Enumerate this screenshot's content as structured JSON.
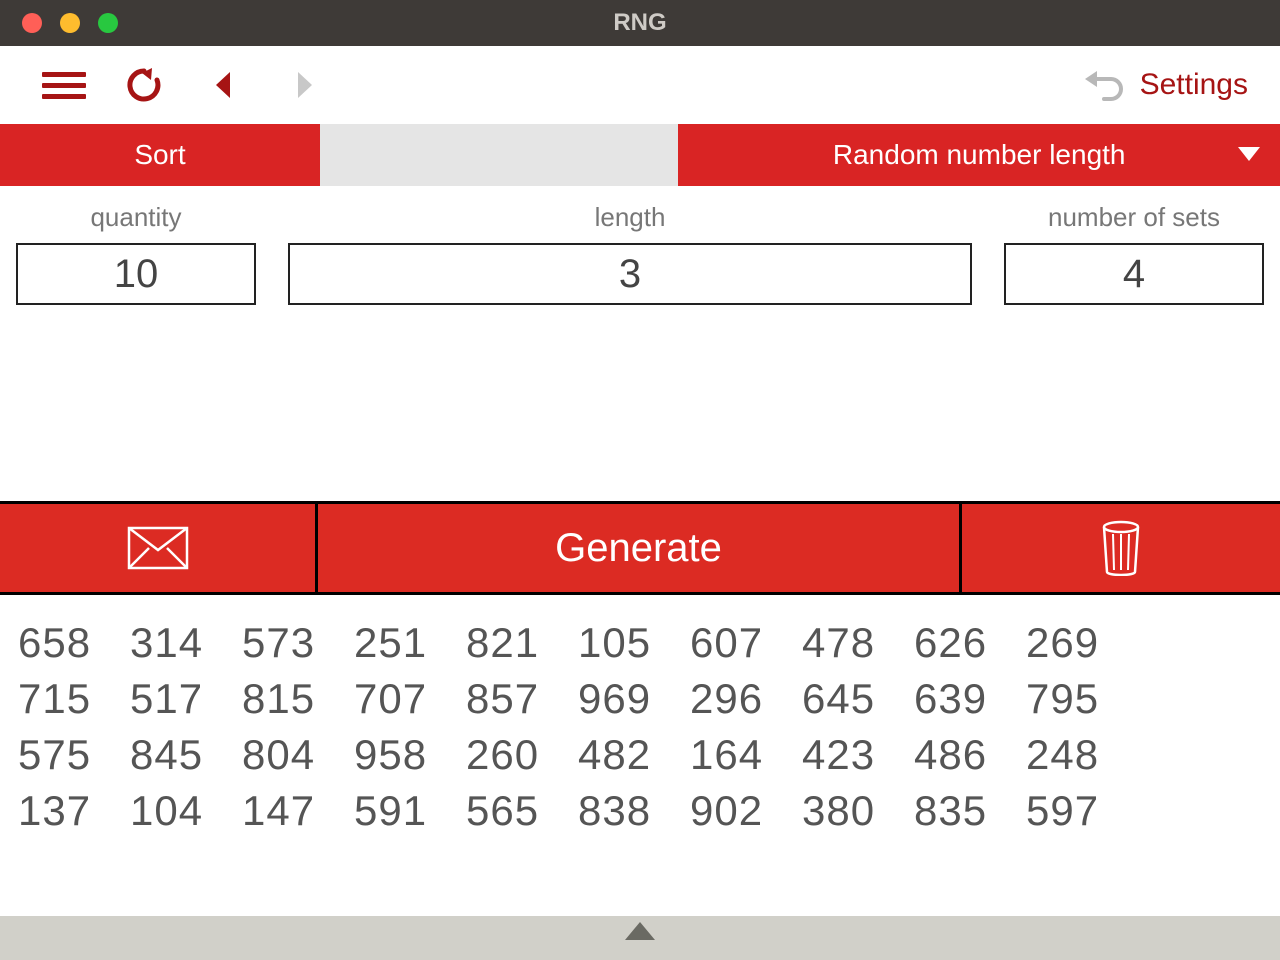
{
  "window": {
    "title": "RNG"
  },
  "toolbar": {
    "settings_label": "Settings"
  },
  "tabs": {
    "sort_label": "Sort",
    "rnl_label": "Random number length"
  },
  "inputs": {
    "quantity": {
      "label": "quantity",
      "value": "10"
    },
    "length": {
      "label": "length",
      "value": "3"
    },
    "sets": {
      "label": "number of sets",
      "value": "4"
    }
  },
  "actions": {
    "generate_label": "Generate"
  },
  "results": [
    [
      "658",
      "314",
      "573",
      "251",
      "821",
      "105",
      "607",
      "478",
      "626",
      "269"
    ],
    [
      "715",
      "517",
      "815",
      "707",
      "857",
      "969",
      "296",
      "645",
      "639",
      "795"
    ],
    [
      "575",
      "845",
      "804",
      "958",
      "260",
      "482",
      "164",
      "423",
      "486",
      "248"
    ],
    [
      "137",
      "104",
      "147",
      "591",
      "565",
      "838",
      "902",
      "380",
      "835",
      "597"
    ]
  ],
  "colors": {
    "brand_red": "#d92424",
    "dark_red": "#a61414",
    "action_red": "#dc2b23"
  }
}
